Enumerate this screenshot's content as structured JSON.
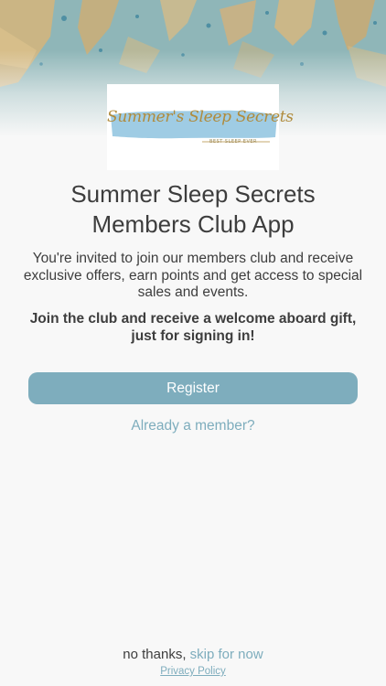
{
  "hero": {
    "image": "beach-sand-water-illustration"
  },
  "logo": {
    "title": "Summer's Sleep Secrets",
    "tagline": "BEST SLEEP EVER"
  },
  "header": {
    "title_line1": "Summer Sleep Secrets",
    "title_line2": "Members Club App"
  },
  "body": {
    "invite_text": "You're invited to join our members club and receive exclusive offers, earn points and get access to special sales and events.",
    "gift_text": "Join the club and receive a welcome aboard gift, just for signing in!"
  },
  "actions": {
    "register_label": "Register",
    "member_label": "Already a member?",
    "no_thanks_label": "no thanks,",
    "skip_label": "skip for now",
    "privacy_label": "Privacy Policy"
  },
  "colors": {
    "accent": "#7eadbd",
    "text": "#3d3d3d",
    "background": "#f8f8f8",
    "logo_gold": "#b08b3c",
    "logo_blue": "#8ec3df"
  }
}
